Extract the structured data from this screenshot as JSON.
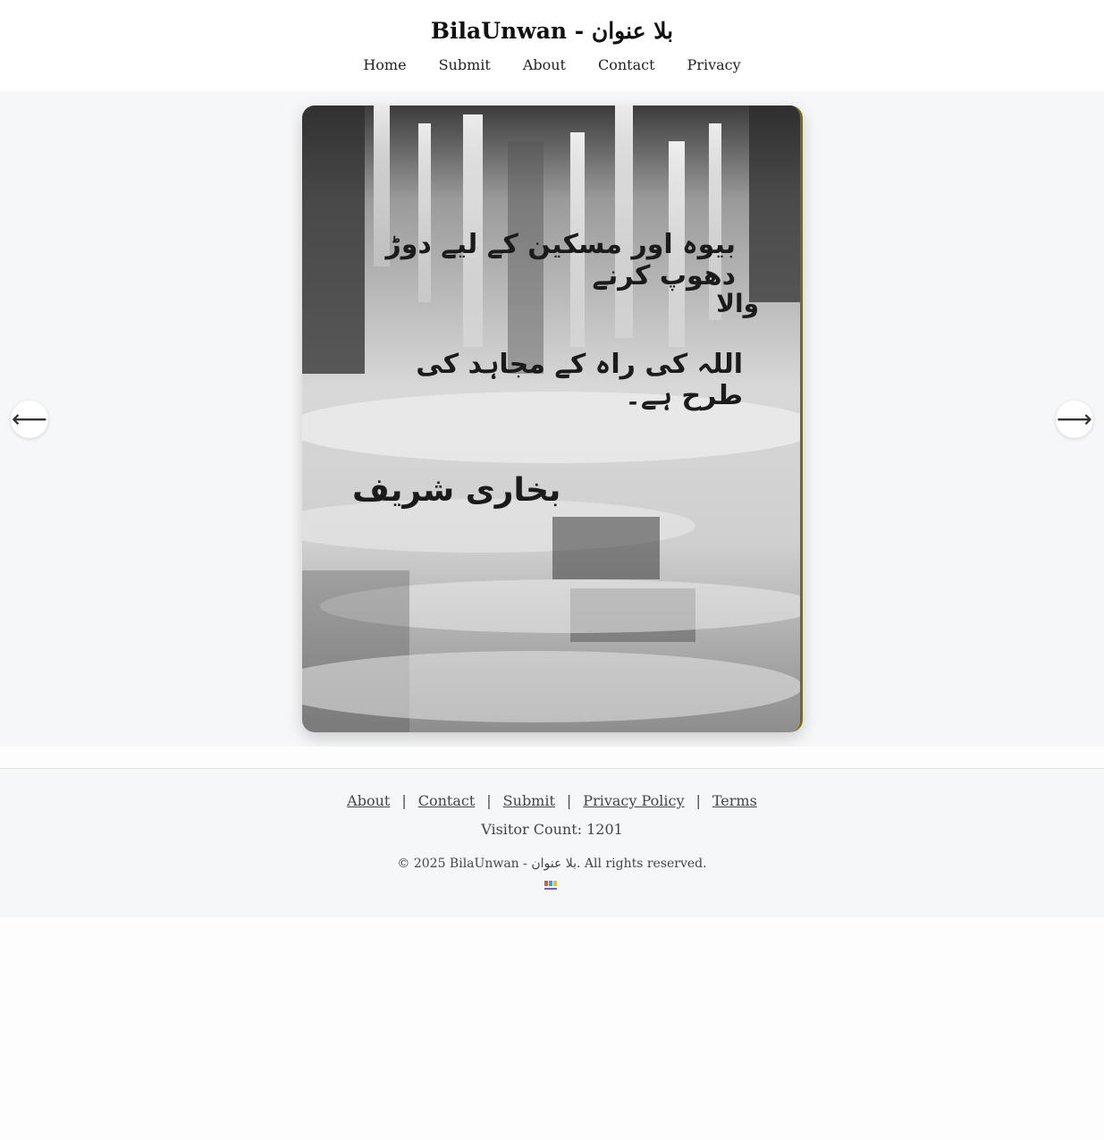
{
  "site": {
    "title": "BilaUnwan - بلا عنوان"
  },
  "nav": {
    "items": [
      "Home",
      "Submit",
      "About",
      "Contact",
      "Privacy"
    ]
  },
  "slide": {
    "lines": [
      "بیوہ اور مسکین کے لیے دوڑ دھوپ کرنے",
      "والا",
      "اللہ کی راہ کے مجاہد کی طرح ہے۔",
      "بخاری شریف"
    ],
    "prev_icon": "arrow-left-icon",
    "next_icon": "arrow-right-icon",
    "prev_glyph": "⟵",
    "next_glyph": "⟶",
    "border_accent": "#7a6a10"
  },
  "footer": {
    "links": [
      "About",
      "Contact",
      "Submit",
      "Privacy Policy",
      "Terms"
    ],
    "separator": "|",
    "visitor_count": "Visitor Count: 1201",
    "copyright": "© 2025 BilaUnwan - بلا عنوان. All rights reserved.",
    "logo_icon": "site-logo-icon"
  }
}
